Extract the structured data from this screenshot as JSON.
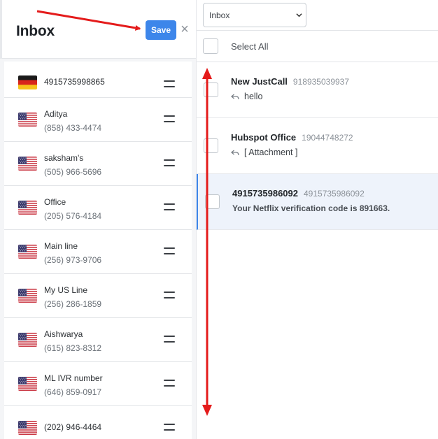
{
  "left_panel": {
    "title": "Inbox",
    "save_label": "Save",
    "close_symbol": "×",
    "numbers": [
      {
        "name": "4915735998865",
        "phone": "",
        "flag": "germany-flag"
      },
      {
        "name": "Aditya",
        "phone": "(858) 433-4474",
        "flag": "us-flag"
      },
      {
        "name": "saksham's",
        "phone": "(505) 966-5696",
        "flag": "us-flag"
      },
      {
        "name": "Office",
        "phone": "(205) 576-4184",
        "flag": "us-flag"
      },
      {
        "name": "Main line",
        "phone": "(256) 973-9706",
        "flag": "us-flag"
      },
      {
        "name": "My US Line",
        "phone": "(256) 286-1859",
        "flag": "us-flag"
      },
      {
        "name": "Aishwarya",
        "phone": "(615) 823-8312",
        "flag": "us-flag"
      },
      {
        "name": "ML IVR number",
        "phone": "(646) 859-0917",
        "flag": "us-flag"
      },
      {
        "name": "(202) 946-4464",
        "phone": "",
        "flag": "us-flag"
      }
    ]
  },
  "right_panel": {
    "filter_selected": "Inbox",
    "select_all_label": "Select All",
    "messages": [
      {
        "name": "New JustCall",
        "number": "918935039937",
        "preview": "hello",
        "icon": "reply-icon"
      },
      {
        "name": "Hubspot Office",
        "number": "19044748272",
        "preview": "[ Attachment ]",
        "icon": "reply-icon"
      },
      {
        "name": "4915735986092",
        "number": "4915735986092",
        "preview": "Your Netflix verification code is 891663.",
        "icon": ""
      }
    ]
  },
  "colors": {
    "accent": "#3d86ea",
    "annotation": "#e41b1b",
    "active_row": "#eef3fb"
  }
}
